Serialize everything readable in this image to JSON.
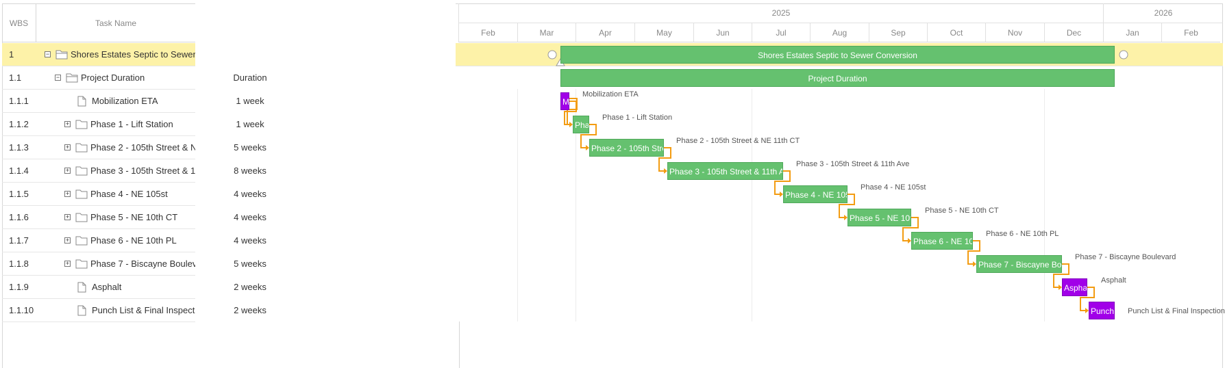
{
  "header": {
    "wbs": "WBS",
    "task_name": "Task Name",
    "duration": "Duration",
    "years": [
      "2025",
      "2026"
    ],
    "months": [
      "Feb",
      "Mar",
      "Apr",
      "May",
      "Jun",
      "Jul",
      "Aug",
      "Sep",
      "Oct",
      "Nov",
      "Dec",
      "Jan",
      "Feb"
    ]
  },
  "tasks": [
    {
      "wbs": "1",
      "name": "Shores Estates Septic to Sewer Conversion",
      "duration": "",
      "type": "folder-open",
      "toggle": "−"
    },
    {
      "wbs": "1.1",
      "name": "Project Duration",
      "duration": "Duration",
      "type": "folder-open",
      "toggle": "−"
    },
    {
      "wbs": "1.1.1",
      "name": "Mobilization ETA",
      "duration": "1 week",
      "type": "file",
      "toggle": ""
    },
    {
      "wbs": "1.1.2",
      "name": "Phase 1 - Lift Station",
      "duration": "1 week",
      "type": "folder",
      "toggle": "+"
    },
    {
      "wbs": "1.1.3",
      "name": "Phase 2 - 105th Street & NE 11th CT",
      "duration": "5 weeks",
      "type": "folder",
      "toggle": "+"
    },
    {
      "wbs": "1.1.4",
      "name": "Phase 3 - 105th Street & 11th Ave",
      "duration": "8 weeks",
      "type": "folder",
      "toggle": "+"
    },
    {
      "wbs": "1.1.5",
      "name": "Phase 4 - NE 105st",
      "duration": "4 weeks",
      "type": "folder",
      "toggle": "+"
    },
    {
      "wbs": "1.1.6",
      "name": "Phase 5 - NE 10th CT",
      "duration": "4 weeks",
      "type": "folder",
      "toggle": "+"
    },
    {
      "wbs": "1.1.7",
      "name": "Phase 6 - NE 10th PL",
      "duration": "4 weeks",
      "type": "folder",
      "toggle": "+"
    },
    {
      "wbs": "1.1.8",
      "name": "Phase 7 - Biscayne Boulevard",
      "duration": "5 weeks",
      "type": "folder",
      "toggle": "+"
    },
    {
      "wbs": "1.1.9",
      "name": "Asphalt",
      "duration": "2 weeks",
      "type": "file",
      "toggle": ""
    },
    {
      "wbs": "1.1.10",
      "name": "Punch List & Final Inspection",
      "duration": "2 weeks",
      "type": "file",
      "toggle": ""
    }
  ],
  "bars": [
    {
      "text": "Shores Estates Septic to Sewer Conversion",
      "label": "",
      "color": "green"
    },
    {
      "text": "Project Duration",
      "label": "",
      "color": "green"
    },
    {
      "text": "Mobilization ETA",
      "label": "Mobilization ETA",
      "color": "purple"
    },
    {
      "text": "Phase 1 - Lift Station",
      "label": "Phase 1 - Lift Station",
      "color": "green"
    },
    {
      "text": "Phase 2 - 105th Street & NE 11th CT",
      "label": "Phase 2 - 105th Street & NE 11th CT",
      "color": "green"
    },
    {
      "text": "Phase 3 - 105th Street & 11th Ave",
      "label": "Phase 3 - 105th Street & 11th Ave",
      "color": "green"
    },
    {
      "text": "Phase 4 - NE 105st",
      "label": "Phase 4 - NE 105st",
      "color": "green"
    },
    {
      "text": "Phase 5 - NE 10th CT",
      "label": "Phase 5 - NE 10th CT",
      "color": "green"
    },
    {
      "text": "Phase 6 - NE 10th PL",
      "label": "Phase 6 - NE 10th PL",
      "color": "green"
    },
    {
      "text": "Phase 7 - Biscayne Boulevard",
      "label": "Phase 7 - Biscayne Boulevard",
      "color": "green"
    },
    {
      "text": "Asphalt",
      "label": "Asphalt",
      "color": "purple"
    },
    {
      "text": "Punch List & Final Inspection",
      "label": "Punch List & Final Inspection",
      "color": "purple"
    }
  ],
  "colors": {
    "selected_row": "#fdf2a8",
    "bar_green": "#65c16f",
    "bar_purple": "#a100e8",
    "link": "#f39c12"
  }
}
